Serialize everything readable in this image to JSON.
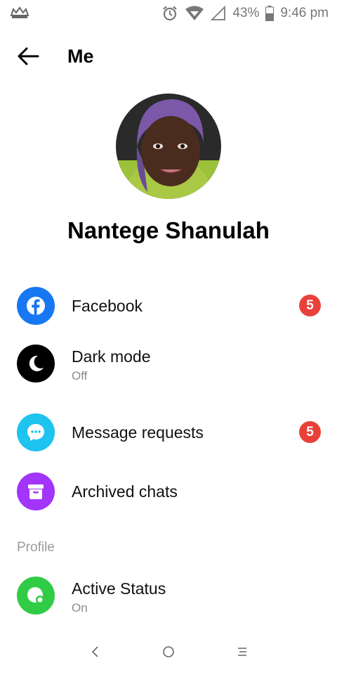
{
  "status_bar": {
    "battery": "43%",
    "time": "9:46 pm",
    "icons": [
      "crown-app-icon",
      "alarm-icon",
      "wifi-icon",
      "signal-icon",
      "battery-icon"
    ]
  },
  "header": {
    "title": "Me",
    "back_icon": "arrow-left-icon"
  },
  "profile": {
    "name": "Nantege Shanulah"
  },
  "menu": {
    "facebook": {
      "label": "Facebook",
      "badge": "5",
      "icon": "facebook-icon",
      "color": "#1877f2"
    },
    "dark_mode": {
      "label": "Dark mode",
      "sublabel": "Off",
      "icon": "moon-icon",
      "color": "#000000"
    },
    "message_requests": {
      "label": "Message requests",
      "badge": "5",
      "icon": "chat-bubble-icon",
      "color": "#1ec3f0"
    },
    "archived_chats": {
      "label": "Archived chats",
      "icon": "archive-box-icon",
      "color": "#a334fa"
    }
  },
  "profile_section": {
    "header": "Profile",
    "active_status": {
      "label": "Active Status",
      "sublabel": "On",
      "icon": "active-status-icon",
      "color": "#31cc46"
    }
  },
  "nav_bar": {
    "icons": [
      "back-nav-icon",
      "home-nav-icon",
      "menu-nav-icon"
    ]
  }
}
